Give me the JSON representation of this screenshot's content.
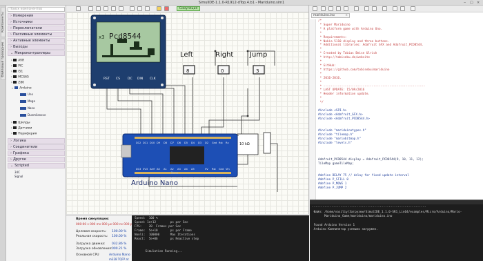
{
  "window": {
    "title": "SimulIDE-1.1.0-R1912-dTop.4.b1 - Mariduino.sim1",
    "close": "×",
    "max": "▢",
    "min": "‒"
  },
  "vtabs": [
    "Компоненты",
    "Файловый проводник"
  ],
  "sidebar": {
    "search_placeholder": "Поиск компонентов",
    "categories": [
      "Измерения",
      "Источники",
      "Переключатели",
      "Пассивные элементы",
      "Активные элементы",
      "Выходы",
      "Микроконтроллеры"
    ],
    "mcu_items": [
      "AVR",
      "PIC",
      "I51",
      "MCS65",
      "Z80",
      "Arduino"
    ],
    "arduino_boards": [
      "Uno",
      "Mega",
      "Nano",
      "Duemilanove"
    ],
    "mcu_after": [
      "Шилды",
      "Датчики",
      "Периферия"
    ],
    "lower_categories": [
      "Логика",
      "Соединители",
      "Графика",
      "Другое",
      "Scripted"
    ],
    "scripted_items": [
      "34C",
      "Signal"
    ]
  },
  "circuit": {
    "sim_button": "Симуляция",
    "lcd_label": "Pcd8544",
    "lcd_pins": [
      "RST",
      "CS",
      "DC",
      "DIN",
      "CLK"
    ],
    "lcd_screen_text": "x3",
    "buttons": [
      {
        "label": "Left",
        "value": "8"
      },
      {
        "label": "Right",
        "value": "0"
      },
      {
        "label": "Jump",
        "value": "3"
      }
    ],
    "resistor": "10 kΩ",
    "arduino_label": "Arduino Nano",
    "arduino_chip_label": "Nano"
  },
  "editor": {
    "tab": "mariduino.ino",
    "tab_close": "×",
    "code": [
      {
        "t": "cm",
        "s": "/*"
      },
      {
        "t": "cm",
        "s": " * Super Mariduino"
      },
      {
        "t": "cm",
        "s": " * A platform game with Arduino Uno."
      },
      {
        "t": "cm",
        "s": " *"
      },
      {
        "t": "cm",
        "s": " * Requirements:"
      },
      {
        "t": "cm",
        "s": " * Nokia 5110 display and three buttons."
      },
      {
        "t": "cm",
        "s": " * Additional libraries: Adafruit GFX and Adafruit_PCD8544."
      },
      {
        "t": "cm",
        "s": " *"
      },
      {
        "t": "cm",
        "s": " * Created by Tobias Beise Ulrich"
      },
      {
        "t": "cm",
        "s": " * http://tobisebu.de/website"
      },
      {
        "t": "cm",
        "s": " *"
      },
      {
        "t": "cm",
        "s": " * GitHub:"
      },
      {
        "t": "cm",
        "s": " * https://github.com/tobisebu/mariduino"
      },
      {
        "t": "cm",
        "s": " *"
      },
      {
        "t": "cm",
        "s": " * 2016-2016."
      },
      {
        "t": "cm",
        "s": " *"
      },
      {
        "t": "cm",
        "s": " * ---------------------------------------------------------"
      },
      {
        "t": "cm",
        "s": " * LAST UPDATE: 15/09/2016"
      },
      {
        "t": "cm",
        "s": " * Header information update."
      },
      {
        "t": "cm",
        "s": " *"
      },
      {
        "t": "cm",
        "s": " */"
      },
      {
        "t": "tx",
        "s": ""
      },
      {
        "t": "pp",
        "s": "#include <SPI.h>"
      },
      {
        "t": "pp",
        "s": "#include <Adafruit_GFX.h>"
      },
      {
        "t": "pp",
        "s": "#include <Adafruit_PCD8544.h>"
      },
      {
        "t": "tx",
        "s": ""
      },
      {
        "t": "tx",
        "s": ""
      },
      {
        "t": "pp",
        "s": "#include \"mariduinotypes.h\""
      },
      {
        "t": "pp",
        "s": "#include \"tilemap.h\""
      },
      {
        "t": "pp",
        "s": "#include \"mariobitmap.h\""
      },
      {
        "t": "pp",
        "s": "#include \"levels.h\""
      },
      {
        "t": "tx",
        "s": ""
      },
      {
        "t": "tx",
        "s": ""
      },
      {
        "t": "tx",
        "s": ""
      },
      {
        "t": "tx",
        "s": "Adafruit_PCD8544 display = Adafruit_PCD8544(9, 10, 11, 12);"
      },
      {
        "t": "tx",
        "s": "TileMap gameTileMap;"
      },
      {
        "t": "tx",
        "s": ""
      },
      {
        "t": "tx",
        "s": ""
      },
      {
        "t": "pp",
        "s": "#define DELAY 75 // delay for fixed update interval"
      },
      {
        "t": "pp",
        "s": "#define P_STILL 0"
      },
      {
        "t": "pp",
        "s": "#define P_MOVE 1"
      },
      {
        "t": "pp",
        "s": "#define P_JUMP 2"
      }
    ]
  },
  "console": {
    "lines": [
      "----------------------------------------------------------------",
      " Файл: /home/vasiliy/Загрузки/SimulIDE_1.1.0-SR1_Lin64/examples/Micro/Arduino/Mario-",
      "       Mariduino_Game/mariduino/mariduino.ino",
      "",
      " Found Arduino Version 1",
      " Arduino Компилятор успешно загружен."
    ]
  },
  "status": {
    "sim_time_label": "Время симуляции:",
    "sim_time_value": "000:00 s 000 ms 000 µs 000 ns 000 ps",
    "target_speed_label": "Целевая скорость:",
    "target_speed_value": "100.00 %",
    "real_speed_label": "Реальная скорость:",
    "real_speed_value": "100.00 %",
    "engine_load_label": "Загрузка движка:",
    "engine_load_value": "032.86 %",
    "update_load_label": "Загрузка обновления:",
    "update_load_value": "000.21 %",
    "cpu_label": "Основной CPU",
    "cpu_value": "Arduino Nano",
    "cpu_sub": "m328 TQFP at"
  },
  "sim_log": [
    "Speed:  100 %",
    "Speed: 1e+12        ps per Sec",
    "FPS:    20  Frames per Sec",
    "Frame:  5e+10       ps per Frame",
    "Nonli:  100000      Max Iterations",
    "React:  5e+06       ps Reactive step",
    "",
    "",
    "      Simulation Running..."
  ]
}
